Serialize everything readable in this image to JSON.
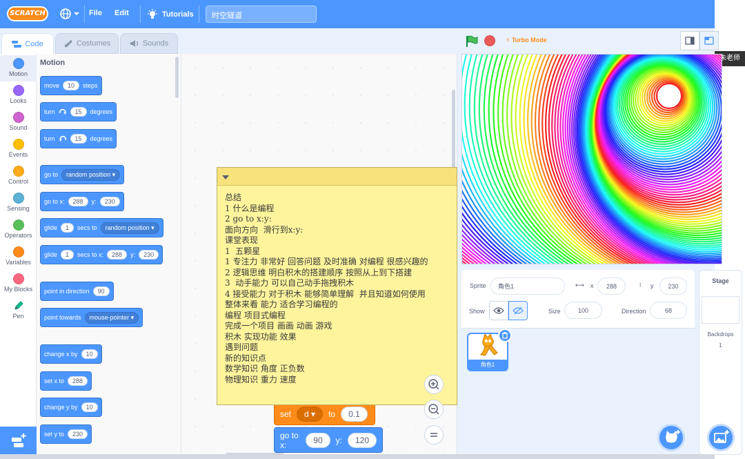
{
  "menubar": {
    "logo": "SCRATCH",
    "file": "File",
    "edit": "Edit",
    "tutorials": "Tutorials",
    "project_title": "时空隧道"
  },
  "tabs": {
    "code": "Code",
    "costumes": "Costumes",
    "sounds": "Sounds"
  },
  "categories": [
    {
      "label": "Motion",
      "color": "#4c97ff"
    },
    {
      "label": "Looks",
      "color": "#9966ff"
    },
    {
      "label": "Sound",
      "color": "#cf63cf"
    },
    {
      "label": "Events",
      "color": "#ffbf00"
    },
    {
      "label": "Control",
      "color": "#ffab19"
    },
    {
      "label": "Sensing",
      "color": "#5cb1d6"
    },
    {
      "label": "Operators",
      "color": "#59c059"
    },
    {
      "label": "Variables",
      "color": "#ff8c1a"
    },
    {
      "label": "My Blocks",
      "color": "#ff6680"
    },
    {
      "label": "Pen",
      "color": "#0fbd8c"
    }
  ],
  "palette": {
    "heading": "Motion",
    "move": {
      "a": "move",
      "v": "10",
      "b": "steps"
    },
    "turn_right": {
      "a": "turn",
      "v": "15",
      "b": "degrees"
    },
    "turn_left": {
      "a": "turn",
      "v": "15",
      "b": "degrees"
    },
    "goto": {
      "a": "go to",
      "d": "random position"
    },
    "gotoxy": {
      "a": "go to x:",
      "x": "288",
      "b": "y:",
      "y": "230"
    },
    "glide": {
      "a": "glide",
      "v": "1",
      "b": "secs to",
      "d": "random position"
    },
    "glidexy": {
      "a": "glide",
      "v": "1",
      "b": "secs to x:",
      "x": "288",
      "c": "y:",
      "y": "230"
    },
    "point_dir": {
      "a": "point in direction",
      "v": "90"
    },
    "point_towards": {
      "a": "point towards",
      "d": "mouse-pointer"
    },
    "change_x": {
      "a": "change x by",
      "v": "10"
    },
    "set_x": {
      "a": "set x to",
      "v": "288"
    },
    "change_y": {
      "a": "change y by",
      "v": "10"
    },
    "set_y": {
      "a": "set y to",
      "v": "230"
    }
  },
  "comment_text": "总结\n1 什么是编程\n2 go to x:y:\n面向方向  滑行到x:y:\n课堂表现\n1  五颗星\n1 专注力 非常好 回答问题 及时准确 对编程 很感兴趣的\n2 逻辑思维 明白积木的搭建顺序 按照从上到下搭建\n3  动手能力 可以自己动手拖拽积木\n4 接受能力 对于积木 能够简单理解  并且知道如何使用\n整体来看 能力 适合学习编程的\n编程 项目式编程\n完成一个项目 画画 动画 游戏\n积木 实现功能 效果\n遇到问题\n新的知识点\n数学知识 角度 正负数\n物理知识 重力 速度",
  "script": {
    "set": {
      "a": "set",
      "var": "d",
      "b": "to",
      "v": "0.1"
    },
    "gotoxy": {
      "a": "go to x:",
      "x": "90",
      "b": "y:",
      "y": "120"
    }
  },
  "stage_header": {
    "turbo": "Turbo Mode"
  },
  "watermark": "朱老师",
  "sprite_info": {
    "sprite_label": "Sprite",
    "sprite_name": "角色1",
    "x_label": "x",
    "x": "288",
    "y_label": "y",
    "y": "230",
    "show_label": "Show",
    "size_label": "Size",
    "size": "100",
    "direction_label": "Direction",
    "direction": "68"
  },
  "sprite_tile": {
    "name": "角色1"
  },
  "stage_panel": {
    "title": "Stage",
    "backdrops_label": "Backdrops",
    "backdrops_count": "1"
  }
}
